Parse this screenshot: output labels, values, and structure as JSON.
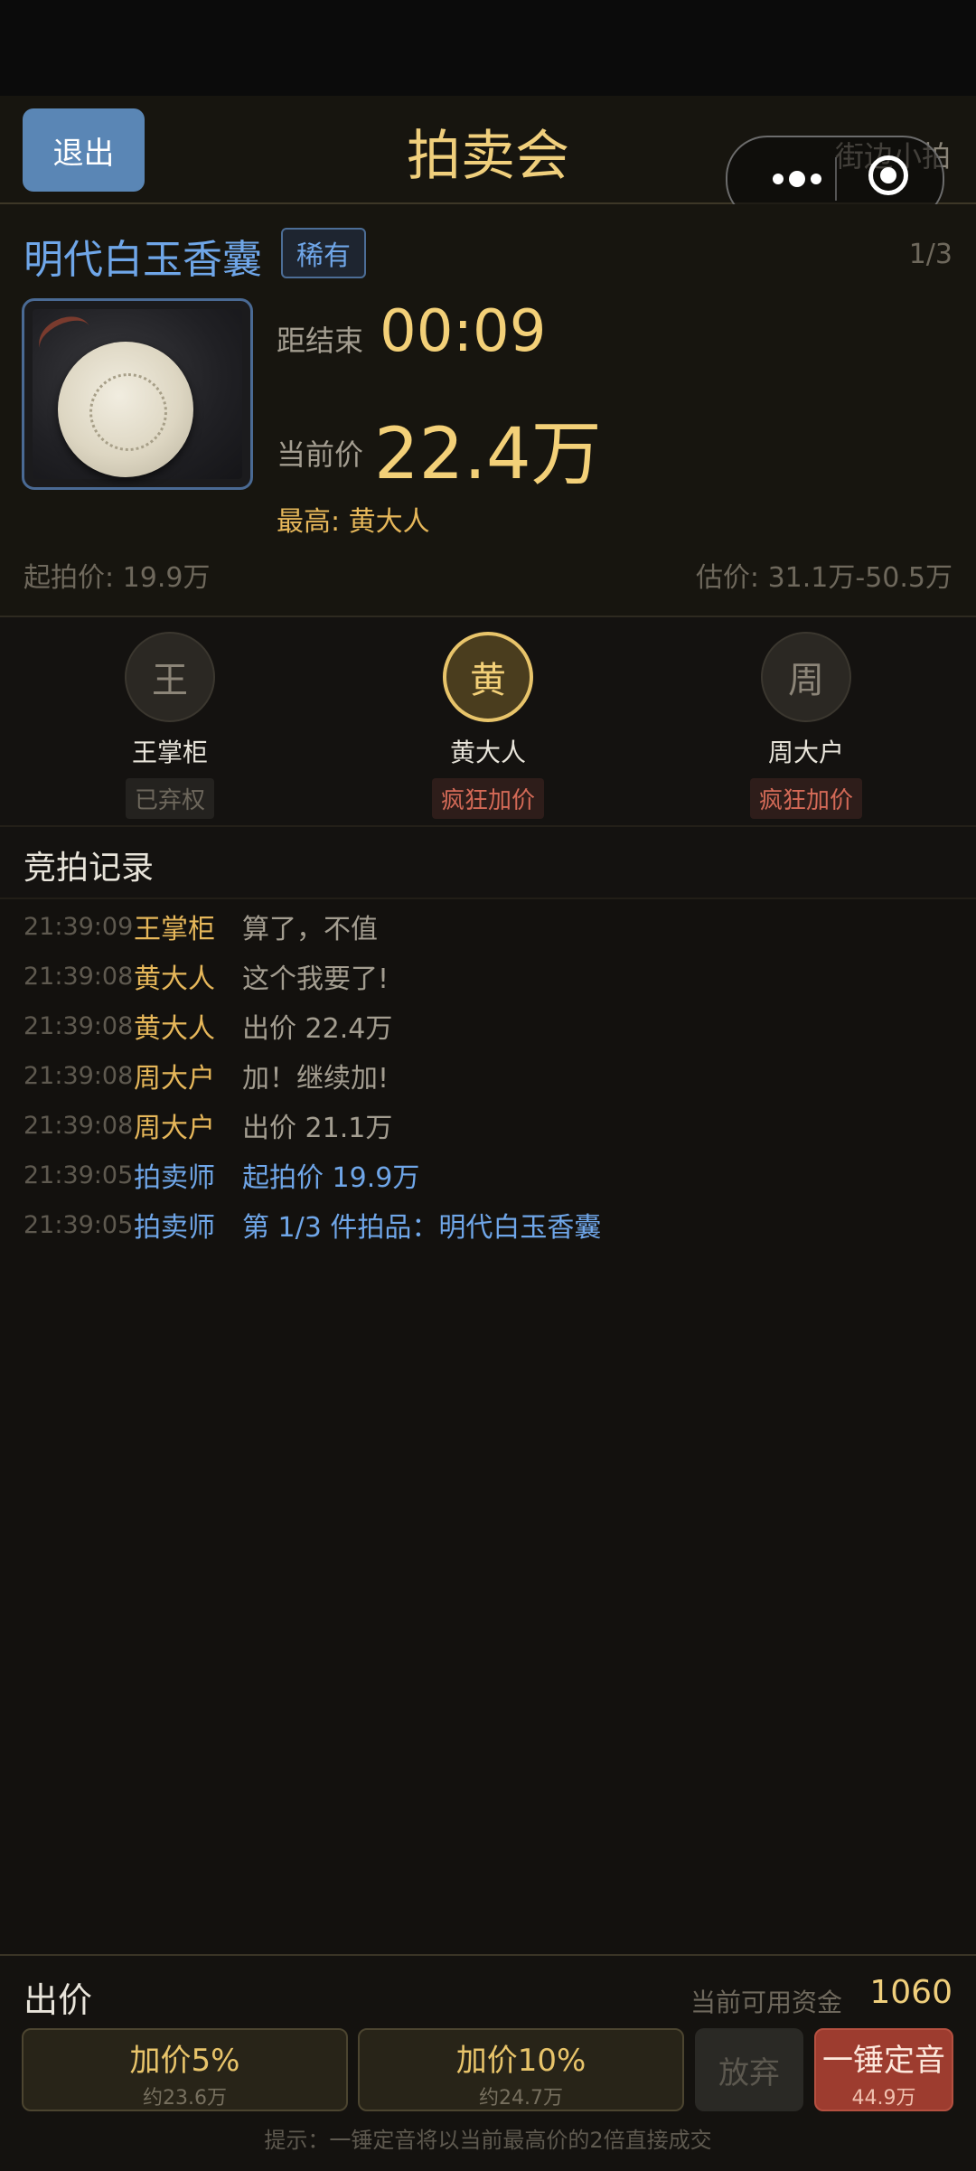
{
  "header": {
    "exit_label": "退出",
    "title": "拍卖会",
    "brand": "街边小拍"
  },
  "item": {
    "name": "明代白玉香囊",
    "rarity": "稀有",
    "lot_count": "1/3",
    "time_label": "距结束",
    "time_value": "00:09",
    "price_label": "当前价",
    "price_value": "22.4万",
    "highest_label": "最高: 黄大人",
    "start_price": "起拍价: 19.9万",
    "estimate": "估价: 31.1万-50.5万"
  },
  "bidders": [
    {
      "avatar": "王",
      "name": "王掌柜",
      "status": "已弃权"
    },
    {
      "avatar": "黄",
      "name": "黄大人",
      "status": "疯狂加价"
    },
    {
      "avatar": "周",
      "name": "周大户",
      "status": "疯狂加价"
    }
  ],
  "log": {
    "title": "竞拍记录",
    "entries": [
      {
        "time": "21:39:09",
        "who": "王掌柜",
        "msg": "算了，不值"
      },
      {
        "time": "21:39:08",
        "who": "黄大人",
        "msg": "这个我要了!"
      },
      {
        "time": "21:39:08",
        "who": "黄大人",
        "msg": "出价 22.4万"
      },
      {
        "time": "21:39:08",
        "who": "周大户",
        "msg": "加！继续加!"
      },
      {
        "time": "21:39:08",
        "who": "周大户",
        "msg": "出价 21.1万"
      },
      {
        "time": "21:39:05",
        "who": "拍卖师",
        "msg": "起拍价 19.9万"
      },
      {
        "time": "21:39:05",
        "who": "拍卖师",
        "msg": "第 1/3 件拍品：明代白玉香囊"
      }
    ]
  },
  "bid_panel": {
    "title": "出价",
    "funds_label": "当前可用资金",
    "funds_value": "1060",
    "raise5_label": "加价5%",
    "raise5_sub": "约23.6万",
    "raise10_label": "加价10%",
    "raise10_sub": "约24.7万",
    "giveup_label": "放弃",
    "hammer_label": "一锤定音",
    "hammer_sub": "44.9万",
    "hint": "提示：一锤定音将以当前最高价的2倍直接成交"
  },
  "colors": {
    "gold": "#f3d078",
    "blue": "#6fa6e8",
    "bidder_name": "#e6b75a",
    "danger": "#9d3c2f"
  }
}
